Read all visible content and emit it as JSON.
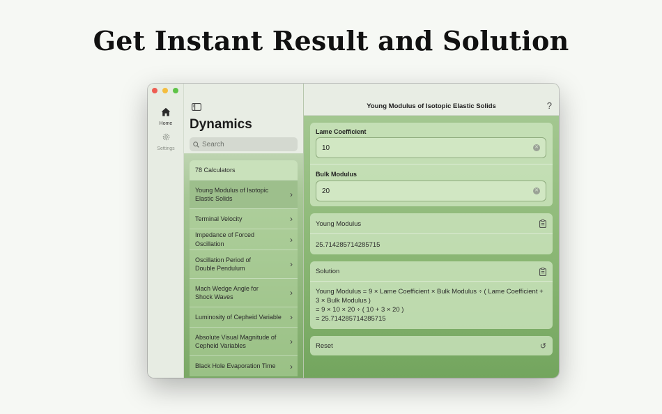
{
  "headline": "Get Instant Result and Solution",
  "rail": {
    "home_label": "Home",
    "settings_label": "Settings"
  },
  "sidebar": {
    "title": "Dynamics",
    "search_placeholder": "Search",
    "count_label": "78 Calculators",
    "items": [
      {
        "line1": "Young Modulus of Isotopic",
        "line2": "Elastic Solids"
      },
      {
        "line1": "Terminal Velocity",
        "line2": ""
      },
      {
        "line1": "Impedance of Forced Oscillation",
        "line2": ""
      },
      {
        "line1": "Oscillation Period of",
        "line2": "Double Pendulum"
      },
      {
        "line1": "Mach Wedge Angle for",
        "line2": "Shock Waves"
      },
      {
        "line1": "Luminosity of Cepheid Variable",
        "line2": ""
      },
      {
        "line1": "Absolute Visual Magnitude of",
        "line2": "Cepheid Variables"
      },
      {
        "line1": "Black Hole Evaporation Time",
        "line2": ""
      }
    ]
  },
  "main": {
    "title": "Young Modulus of Isotopic Elastic Solids",
    "help": "?",
    "inputs": [
      {
        "label": "Lame Coefficient",
        "value": "10"
      },
      {
        "label": "Bulk Modulus",
        "value": "20"
      }
    ],
    "result": {
      "label": "Young Modulus",
      "value": "25.714285714285715"
    },
    "solution": {
      "label": "Solution",
      "lines": [
        "Young Modulus = 9 × Lame Coefficient × Bulk Modulus ÷ ( Lame Coefficient + 3 × Bulk Modulus )",
        "= 9 × 10 × 20 ÷ ( 10 + 3 × 20 )",
        "= 25.714285714285715"
      ]
    },
    "reset_label": "Reset"
  },
  "colors": {
    "accent_green": "#8cb876",
    "selected_row": "#9dbf8c",
    "close": "#ee5d52",
    "minimize": "#f4bd3f",
    "zoom": "#5ec347"
  }
}
